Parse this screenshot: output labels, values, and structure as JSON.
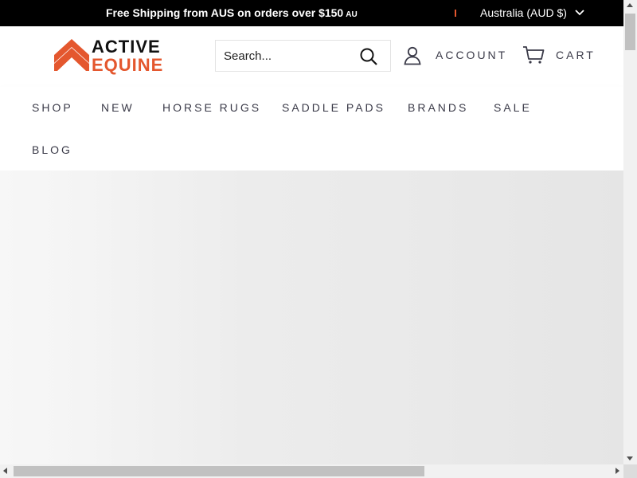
{
  "announcement": {
    "message": "Free Shipping from AUS on orders over $150",
    "message_suffix": "AU",
    "country_selector": "Australia (AUD $)"
  },
  "header": {
    "logo_line1": "ACTIVE",
    "logo_line2": "EQUINE",
    "search_placeholder": "Search...",
    "account_label": "ACCOUNT",
    "cart_label": "CART"
  },
  "nav": {
    "items": [
      {
        "label": "SHOP"
      },
      {
        "label": "NEW"
      },
      {
        "label": "HORSE RUGS"
      },
      {
        "label": "SADDLE PADS"
      },
      {
        "label": "BRANDS"
      },
      {
        "label": "SALE"
      },
      {
        "label": "BLOG"
      }
    ]
  },
  "icons": {
    "search": "search-icon",
    "account": "user-icon",
    "cart": "cart-icon",
    "country_dropdown": "chevron-down-icon"
  },
  "colors": {
    "brand_accent": "#e4572e",
    "announcement_bg": "#000000",
    "nav_text": "#3a3a48"
  }
}
